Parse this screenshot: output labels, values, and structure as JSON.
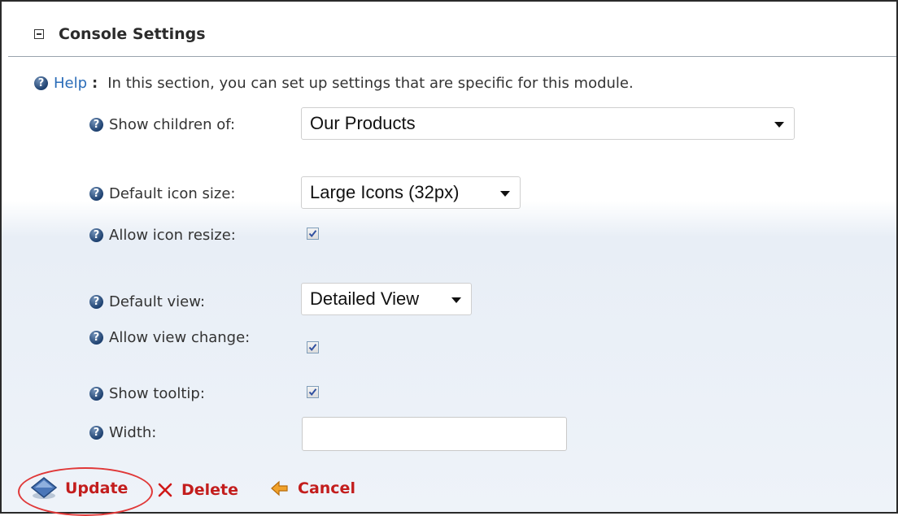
{
  "section": {
    "title": "Console Settings"
  },
  "help": {
    "link_label": "Help",
    "colon": ":",
    "text": "In this section, you can set up settings that are specific for this module."
  },
  "fields": {
    "show_children": {
      "label": "Show children of:",
      "value": "Our Products"
    },
    "default_icon_size": {
      "label": "Default icon size:",
      "value": "Large Icons (32px)"
    },
    "allow_icon_resize": {
      "label": "Allow icon resize:",
      "checked": true
    },
    "default_view": {
      "label": "Default view:",
      "value": "Detailed View"
    },
    "allow_view_change": {
      "label": "Allow view change:",
      "checked": true
    },
    "show_tooltip": {
      "label": "Show tooltip:",
      "checked": true
    },
    "width": {
      "label": "Width:",
      "value": ""
    }
  },
  "actions": {
    "update": "Update",
    "delete": "Delete",
    "cancel": "Cancel"
  },
  "icons": {
    "collapse": "minus-box-icon",
    "help": "question-circle-icon",
    "update": "update-diamond-icon",
    "delete": "x-icon",
    "cancel": "arrow-left-icon"
  },
  "colors": {
    "accent_red": "#c31d1d",
    "link_blue": "#2a6cb8",
    "highlight_circle": "#e03838"
  }
}
